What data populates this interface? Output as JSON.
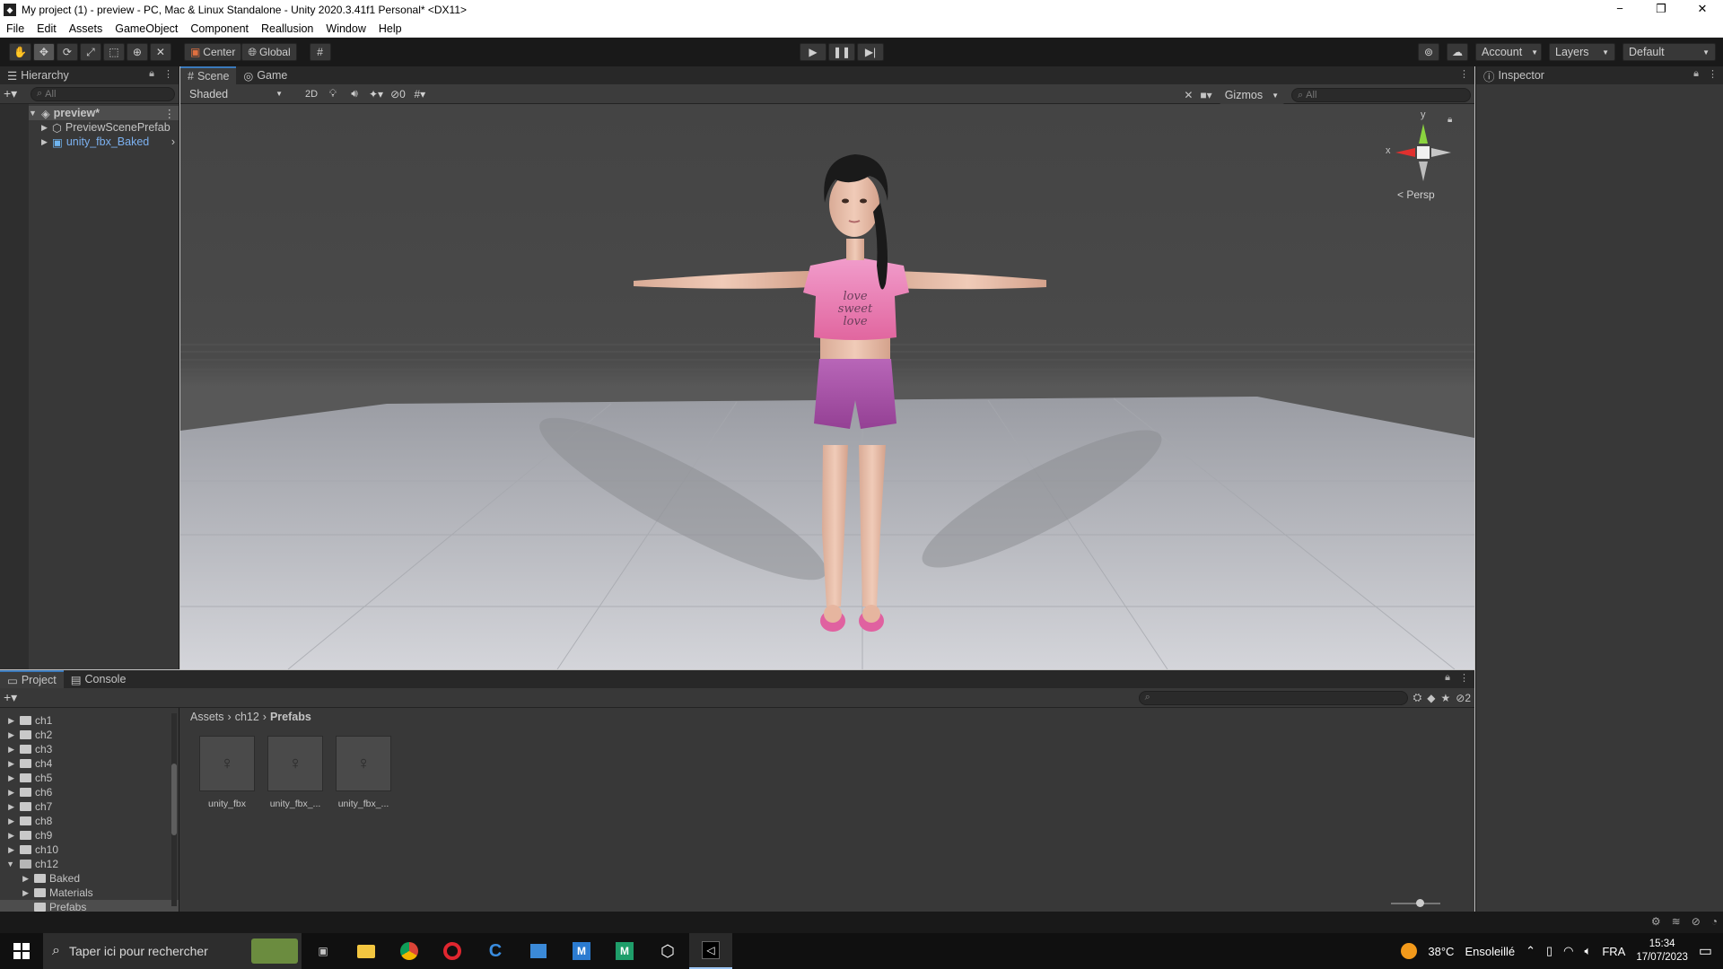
{
  "window": {
    "title": "My project (1) - preview - PC, Mac & Linux Standalone - Unity 2020.3.41f1 Personal* <DX11>",
    "minimize": "−",
    "maximize": "❐",
    "close": "✕"
  },
  "menu": [
    "File",
    "Edit",
    "Assets",
    "GameObject",
    "Component",
    "Reallusion",
    "Window",
    "Help"
  ],
  "toolbar": {
    "pivot_label": "Center",
    "space_label": "Global",
    "account_label": "Account",
    "layers_label": "Layers",
    "layout_label": "Default"
  },
  "hierarchy": {
    "tab": "Hierarchy",
    "search_placeholder": "All",
    "scene_name": "preview*",
    "items": [
      "PreviewScenePrefab",
      "unity_fbx_Baked"
    ]
  },
  "scene_view": {
    "tabs": [
      "Scene",
      "Game"
    ],
    "shading_mode": "Shaded",
    "mode_2d": "2D",
    "hidden_count": "0",
    "gizmos_label": "Gizmos",
    "search_placeholder": "All",
    "persp_label": "< Persp",
    "axis_y": "y",
    "axis_x": "x",
    "shirt_text": "love sweet love"
  },
  "inspector": {
    "tab": "Inspector"
  },
  "project": {
    "tabs": [
      "Project",
      "Console"
    ],
    "tree": [
      "ch1",
      "ch2",
      "ch3",
      "ch4",
      "ch5",
      "ch6",
      "ch7",
      "ch8",
      "ch9",
      "ch10",
      "ch12",
      "Baked",
      "Materials",
      "Prefabs"
    ],
    "breadcrumb": [
      "Assets",
      "ch12",
      "Prefabs"
    ],
    "assets": [
      "unity_fbx",
      "unity_fbx_...",
      "unity_fbx_..."
    ],
    "hidden_count": "2"
  },
  "taskbar": {
    "search_placeholder": "Taper ici pour rechercher",
    "weather_temp": "38°C",
    "weather_desc": "Ensoleillé",
    "language": "FRA",
    "time": "15:34",
    "date": "17/07/2023"
  },
  "colors": {
    "unity_bg": "#383838",
    "unity_dark": "#191919",
    "selection_blue": "#3a79bb",
    "shirt_pink": "#e878b8",
    "shorts_purple": "#a54ea6"
  }
}
